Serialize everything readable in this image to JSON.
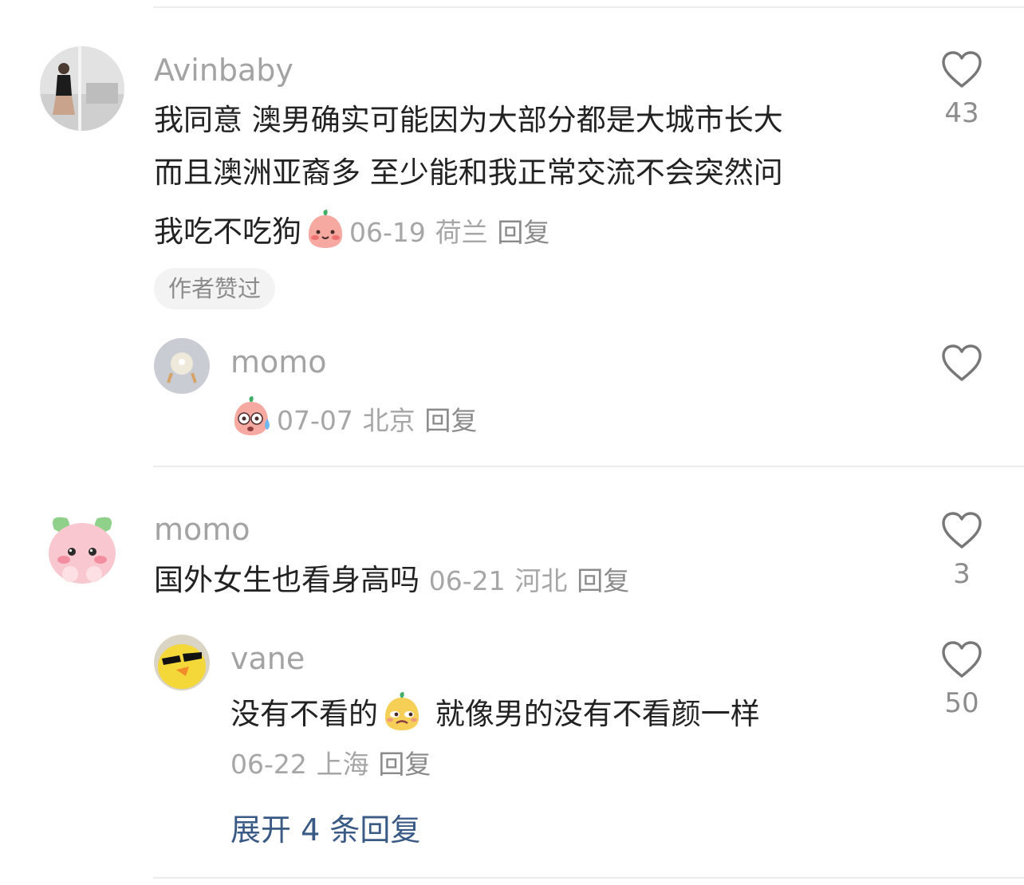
{
  "comments": [
    {
      "username": "Avinbaby",
      "text_lines": [
        "我同意 澳男确实可能因为大部分都是大城市长大",
        "而且澳洲亚裔多 至少能和我正常交流不会突然问",
        "我吃不吃狗"
      ],
      "emoji": "blush-peach-emoji",
      "date": "06-19",
      "location": "荷兰",
      "reply_label": "回复",
      "author_liked_tag": "作者赞过",
      "like_count": "43",
      "replies": [
        {
          "username": "momo",
          "emoji": "sweat-peach-emoji",
          "date": "07-07",
          "location": "北京",
          "reply_label": "回复",
          "like_count": ""
        }
      ]
    },
    {
      "username": "momo",
      "text": "国外女生也看身高吗",
      "date": "06-21",
      "location": "河北",
      "reply_label": "回复",
      "like_count": "3",
      "replies": [
        {
          "username": "vane",
          "text_before_emoji": "没有不看的",
          "emoji": "smug-face-emoji",
          "text_after_emoji": " 就像男的没有不看颜一样",
          "date": "06-22",
          "location": "上海",
          "reply_label": "回复",
          "like_count": "50"
        }
      ],
      "expand_label": "展开 4 条回复"
    }
  ],
  "icons": {
    "like": "heart-outline-icon"
  },
  "colors": {
    "username": "#a3a3a3",
    "body_text": "#222222",
    "meta": "#a6a6a6",
    "link": "#3a5a86",
    "tag_bg": "#f3f3f3"
  }
}
